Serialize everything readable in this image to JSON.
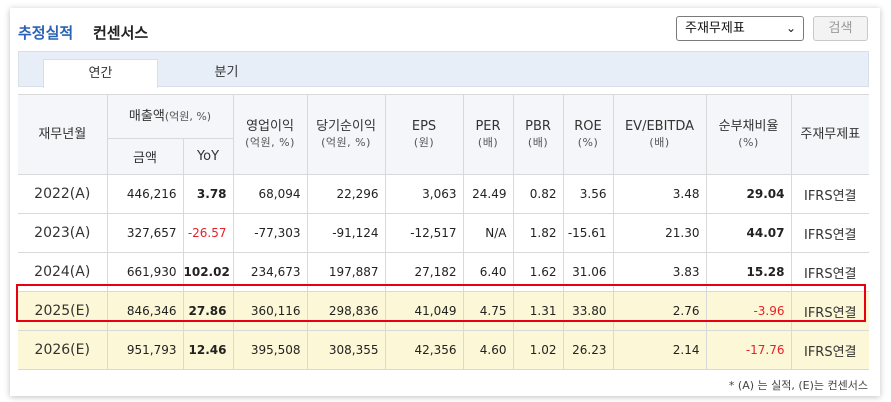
{
  "header": {
    "title_primary": "추정실적",
    "title_secondary": "컨센서스",
    "select_value": "주재무제표",
    "search_label": "검색"
  },
  "tabs": [
    {
      "label": "연간",
      "active": true
    },
    {
      "label": "분기",
      "active": false
    }
  ],
  "table": {
    "col_period": "재무년월",
    "col_sales": "매출액",
    "col_sales_unit": "(억원, %)",
    "col_sales_amount": "금액",
    "col_sales_yoy": "YoY",
    "col_op": "영업이익",
    "col_op_unit": "(억원, %)",
    "col_net": "당기순이익",
    "col_net_unit": "(억원, %)",
    "col_eps": "EPS",
    "col_eps_unit": "(원)",
    "col_per": "PER",
    "col_per_unit": "(배)",
    "col_pbr": "PBR",
    "col_pbr_unit": "(배)",
    "col_roe": "ROE",
    "col_roe_unit": "(%)",
    "col_ev": "EV/EBITDA",
    "col_ev_unit": "(배)",
    "col_debt": "순부채비율",
    "col_debt_unit": "(%)",
    "col_basis": "주재무제표",
    "rows": [
      {
        "period": "2022(A)",
        "sales": "446,216",
        "yoy": "3.78",
        "op": "68,094",
        "net": "22,296",
        "eps": "3,063",
        "per": "24.49",
        "pbr": "0.82",
        "roe": "3.56",
        "ev": "3.48",
        "debt": "29.04",
        "basis": "IFRS연결"
      },
      {
        "period": "2023(A)",
        "sales": "327,657",
        "yoy": "-26.57",
        "op": "-77,303",
        "net": "-91,124",
        "eps": "-12,517",
        "per": "N/A",
        "pbr": "1.82",
        "roe": "-15.61",
        "ev": "21.30",
        "debt": "44.07",
        "basis": "IFRS연결"
      },
      {
        "period": "2024(A)",
        "sales": "661,930",
        "yoy": "102.02",
        "op": "234,673",
        "net": "197,887",
        "eps": "27,182",
        "per": "6.40",
        "pbr": "1.62",
        "roe": "31.06",
        "ev": "3.83",
        "debt": "15.28",
        "basis": "IFRS연결"
      },
      {
        "period": "2025(E)",
        "sales": "846,346",
        "yoy": "27.86",
        "op": "360,116",
        "net": "298,836",
        "eps": "41,049",
        "per": "4.75",
        "pbr": "1.31",
        "roe": "33.80",
        "ev": "2.76",
        "debt": "-3.96",
        "basis": "IFRS연결"
      },
      {
        "period": "2026(E)",
        "sales": "951,793",
        "yoy": "12.46",
        "op": "395,508",
        "net": "308,355",
        "eps": "42,356",
        "per": "4.60",
        "pbr": "1.02",
        "roe": "26.23",
        "ev": "2.14",
        "debt": "-17.76",
        "basis": "IFRS연결"
      }
    ]
  },
  "footnote": "* (A) 는 실적, (E)는 컨센서스",
  "colors": {
    "accent": "#2a62b5",
    "negative": "#e8212a",
    "highlight_border": "#e60012",
    "highlight_bg": "#fcf7d6"
  }
}
